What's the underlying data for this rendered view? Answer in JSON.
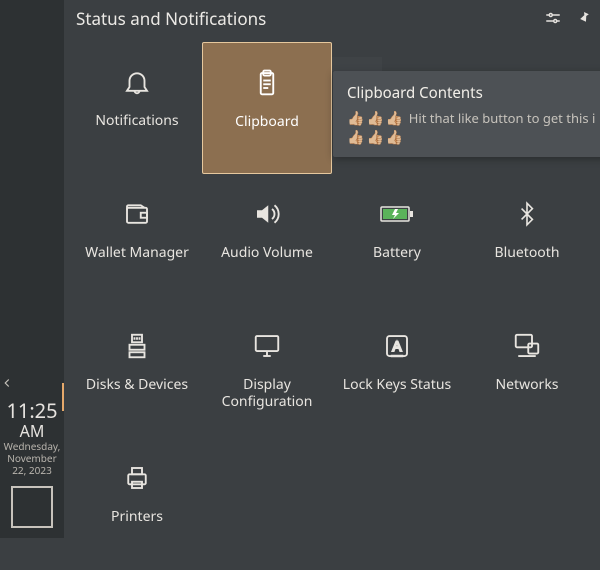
{
  "panel": {
    "title": "Status and Notifications"
  },
  "tooltip": {
    "title": "Clipboard Contents",
    "body_text": "Hit that like button to get this i"
  },
  "clock": {
    "time": "11:25",
    "ampm": "AM",
    "date_line1": "Wednesday,",
    "date_line2": "November",
    "date_line3": "22, 2023"
  },
  "items": {
    "notifications": {
      "label": "Notifications"
    },
    "clipboard": {
      "label": "Clipboard"
    },
    "wallet": {
      "label": "Wallet Manager"
    },
    "audio": {
      "label": "Audio Volume"
    },
    "battery": {
      "label": "Battery"
    },
    "bluetooth": {
      "label": "Bluetooth"
    },
    "disks": {
      "label": "Disks & Devices"
    },
    "display": {
      "label": "Display Configuration"
    },
    "lockkeys": {
      "label": "Lock Keys Status"
    },
    "networks": {
      "label": "Networks"
    },
    "printers": {
      "label": "Printers"
    }
  }
}
